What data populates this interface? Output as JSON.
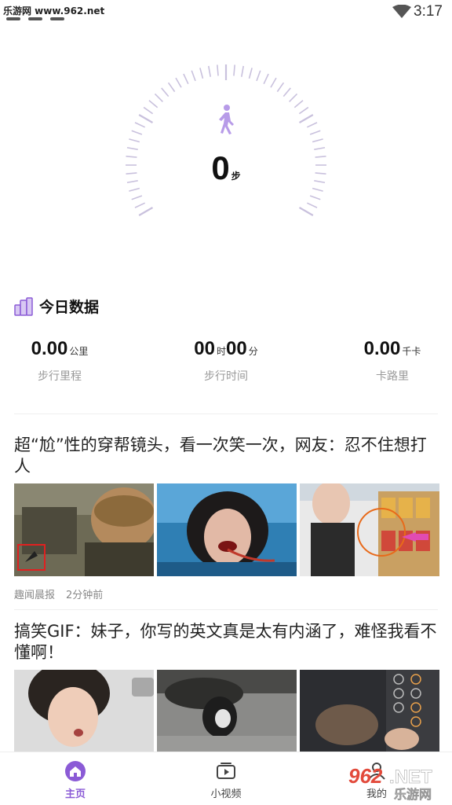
{
  "status_bar": {
    "watermark": "乐游网 www.962.net",
    "time": "3:17"
  },
  "pedometer": {
    "steps": "0",
    "steps_unit": "步",
    "icon": "walking-person-icon",
    "accent_color": "#b79be8"
  },
  "today": {
    "title": "今日数据",
    "icon": "city-buildings-icon",
    "stats": [
      {
        "value": "0.00",
        "unit": "公里",
        "label": "步行里程"
      },
      {
        "hours": "00",
        "hours_unit": "时",
        "minutes": "00",
        "minutes_unit": "分",
        "label": "步行时间"
      },
      {
        "value": "0.00",
        "unit": "千卡",
        "label": "卡路里"
      }
    ]
  },
  "feed": [
    {
      "title": "超“尬”性的穿帮镜头，看一次笑一次，网友：忍不住想打人",
      "source": "趣闻晨报",
      "time": "2分钟前"
    },
    {
      "title": "搞笑GIF：妹子，你写的英文真是太有内涵了，难怪我看不懂啊！"
    }
  ],
  "tabbar": {
    "home": "主页",
    "video": "小视频",
    "mine": "我的"
  },
  "brand": {
    "logo_number": "962",
    "logo_suffix": ".NET",
    "logo_cn": "乐游网"
  },
  "colors": {
    "accent": "#8b5bd6",
    "gauge_tick": "#c9c1dd"
  }
}
